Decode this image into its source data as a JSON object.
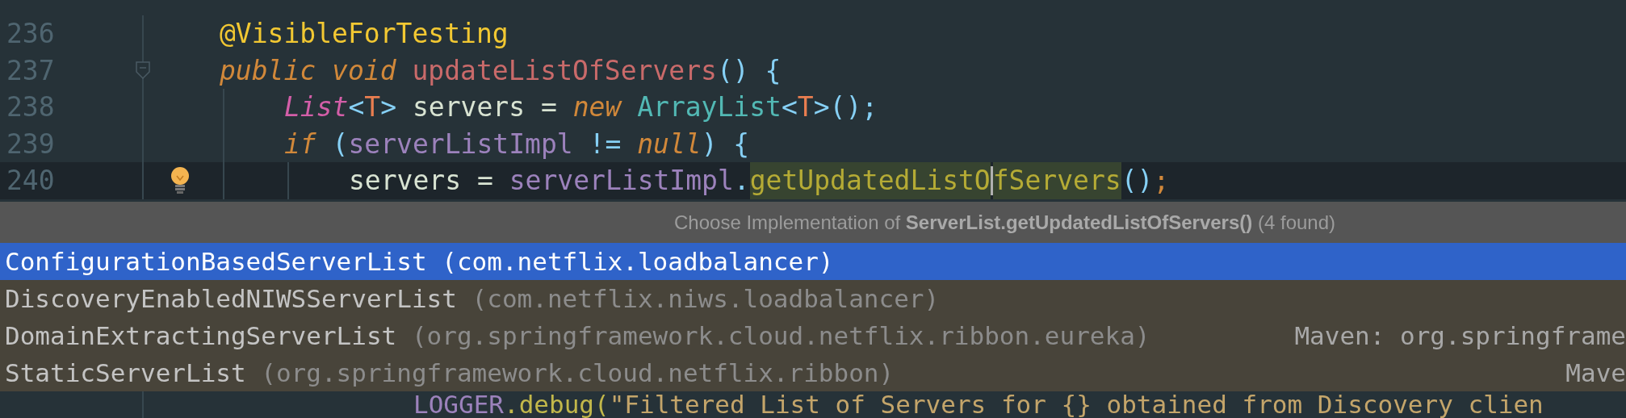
{
  "editor": {
    "lines": [
      {
        "number": "236",
        "current": false,
        "bulb": false,
        "fold": false,
        "tokens": [
          {
            "text": "@VisibleForTesting",
            "kind": "annotation"
          }
        ]
      },
      {
        "number": "237",
        "current": false,
        "bulb": false,
        "fold": true,
        "tokens": [
          {
            "text": "public void ",
            "kind": "keyword"
          },
          {
            "text": "updateListOfServers",
            "kind": "method-decl"
          },
          {
            "text": "() {",
            "kind": "paren"
          }
        ]
      },
      {
        "number": "238",
        "current": false,
        "bulb": false,
        "fold": false,
        "tokens": [
          {
            "kind": "indent"
          },
          {
            "text": "List",
            "kind": "interface"
          },
          {
            "text": "<",
            "kind": "paren"
          },
          {
            "text": "T",
            "kind": "generic"
          },
          {
            "text": ">",
            "kind": "paren"
          },
          {
            "text": " servers = ",
            "kind": "plain"
          },
          {
            "text": "new ",
            "kind": "keyword"
          },
          {
            "text": "ArrayList",
            "kind": "class"
          },
          {
            "text": "<",
            "kind": "paren"
          },
          {
            "text": "T",
            "kind": "generic"
          },
          {
            "text": ">();",
            "kind": "paren"
          }
        ]
      },
      {
        "number": "239",
        "current": false,
        "bulb": false,
        "fold": false,
        "tokens": [
          {
            "kind": "indent"
          },
          {
            "text": "if",
            "kind": "keyword"
          },
          {
            "text": " (",
            "kind": "paren"
          },
          {
            "text": "serverListImpl",
            "kind": "field"
          },
          {
            "text": " != ",
            "kind": "paren"
          },
          {
            "text": "null",
            "kind": "keyword"
          },
          {
            "text": ") {",
            "kind": "paren"
          }
        ]
      },
      {
        "number": "240",
        "current": true,
        "bulb": true,
        "fold": false,
        "tokens": [
          {
            "kind": "indent"
          },
          {
            "kind": "indent"
          },
          {
            "text": "servers = ",
            "kind": "plain"
          },
          {
            "text": "serverListImpl",
            "kind": "field"
          },
          {
            "text": ".",
            "kind": "paren"
          },
          {
            "text": "getUpdatedListO",
            "kind": "usage"
          },
          {
            "kind": "caret"
          },
          {
            "text": "fServers",
            "kind": "usage"
          },
          {
            "text": "()",
            "kind": "paren"
          },
          {
            "text": ";",
            "kind": "semicolon"
          }
        ]
      }
    ],
    "last_line": {
      "tokens": [
        {
          "kind": "indent"
        },
        {
          "kind": "indent"
        },
        {
          "kind": "indent"
        },
        {
          "text": "LOGGER",
          "kind": "field"
        },
        {
          "text": ".debug(",
          "kind": "method-call"
        },
        {
          "text": "\"Filtered List of Servers for {} obtained from Discovery clien",
          "kind": "string"
        }
      ]
    }
  },
  "popup": {
    "title": "Choose Implementation of **ServerList.getUpdatedListOfServers()** (4 found)",
    "items": [
      {
        "name": "ConfigurationBasedServerList",
        "package": "(com.netflix.loadbalancer)",
        "selected": true
      },
      {
        "name": "DiscoveryEnabledNIWSServerList",
        "package": "(com.netflix.niws.loadbalancer)",
        "selected": false
      },
      {
        "name": "DomainExtractingServerList",
        "package": "(org.springframework.cloud.netflix.ribbon.eureka)",
        "location": "Maven: org.springframe",
        "selected": false
      },
      {
        "name": "StaticServerList",
        "package": "(org.springframework.cloud.netflix.ribbon)",
        "location": "Mave",
        "selected": false
      }
    ]
  }
}
